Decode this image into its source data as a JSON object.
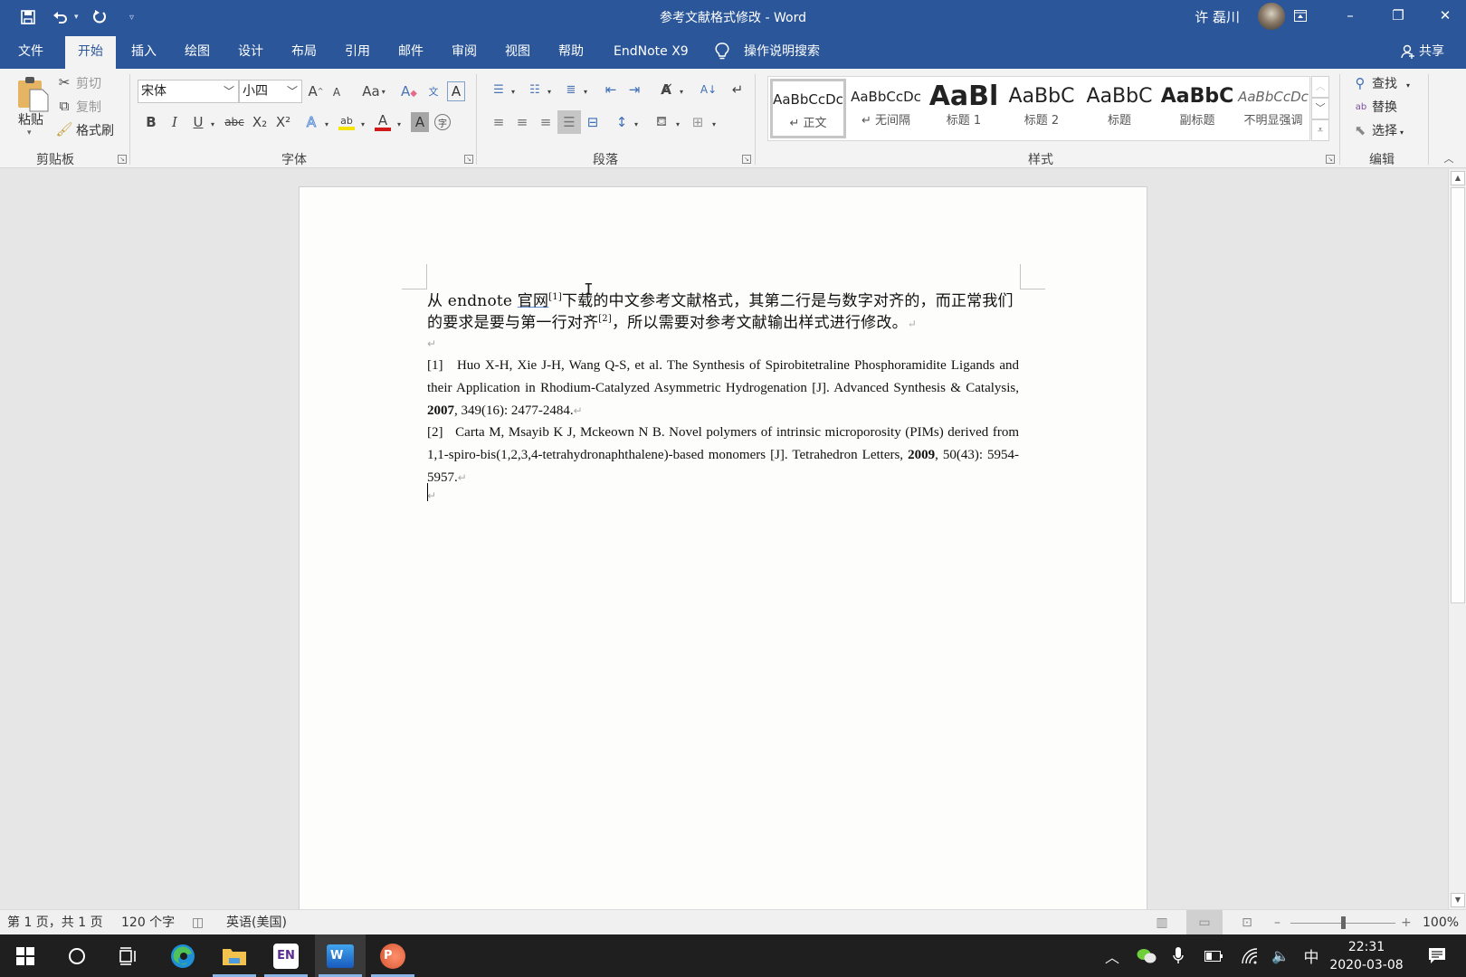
{
  "window": {
    "title": "参考文献格式修改  -  Word",
    "user_name": "许 磊川",
    "controls": {
      "ribbon_display": "▣",
      "minimize": "–",
      "restore": "❐",
      "close": "✕"
    }
  },
  "quick_access": {
    "save_icon": "save-icon",
    "undo_icon": "undo-icon",
    "redo_icon": "redo-icon",
    "customize_icon": "customize-icon"
  },
  "menu_tabs": [
    {
      "label": "文件"
    },
    {
      "label": "开始",
      "active": true
    },
    {
      "label": "插入"
    },
    {
      "label": "绘图"
    },
    {
      "label": "设计"
    },
    {
      "label": "布局"
    },
    {
      "label": "引用"
    },
    {
      "label": "邮件"
    },
    {
      "label": "审阅"
    },
    {
      "label": "视图"
    },
    {
      "label": "帮助"
    },
    {
      "label": "EndNote X9"
    }
  ],
  "tell_me": "操作说明搜索",
  "share": "共享",
  "ribbon": {
    "clipboard": {
      "label": "剪贴板",
      "paste": "粘贴",
      "cut": "剪切",
      "copy": "复制",
      "format_painter": "格式刷"
    },
    "font": {
      "label": "字体",
      "font_name": "宋体",
      "font_size": "小四",
      "grow": "A",
      "shrink": "A",
      "change_case": "Aa",
      "bold": "B",
      "italic": "I",
      "underline": "U",
      "strikethrough": "abc",
      "subscript": "X₂",
      "superscript": "X²",
      "text_effects": "A",
      "highlight": "ab",
      "font_color": "A",
      "char_shading": "A",
      "enclose": "字",
      "highlight_color": "#f5e400",
      "font_color_value": "#d01a1a"
    },
    "paragraph": {
      "label": "段落"
    },
    "styles": {
      "label": "样式",
      "items": [
        {
          "sample": "AaBbCcDc",
          "name": "↵ 正文",
          "selected": true
        },
        {
          "sample": "AaBbCcDc",
          "name": "↵ 无间隔"
        },
        {
          "sample": "AaBl",
          "name": "标题 1"
        },
        {
          "sample": "AaBbC",
          "name": "标题 2"
        },
        {
          "sample": "AaBbC",
          "name": "标题"
        },
        {
          "sample": "AaBbC",
          "name": "副标题"
        },
        {
          "sample": "AaBbCcDc",
          "name": "不明显强调"
        }
      ]
    },
    "editing": {
      "label": "编辑",
      "find": "查找",
      "replace": "替换",
      "select": "选择"
    }
  },
  "document": {
    "intro": {
      "part1": "从 endnote ",
      "link": "官网",
      "sup1": "[1]",
      "part2": "下载的中文参考文献格式，其第二行是与数字对齐的，而正常我们的要求是要与第一行对齐",
      "sup2": "[2]",
      "part3": "，所以需要对参考文献输出样式进行修改。"
    },
    "references": [
      {
        "num": "[1]",
        "before": "Huo X-H, Xie J-H, Wang Q-S, et al. The Synthesis of Spirobitetraline Phosphoramidite Ligands and their Application in Rhodium-Catalyzed Asymmetric Hydrogenation [J]. Advanced Synthesis & Catalysis, ",
        "year": "2007",
        "after": ", 349(16): 2477-2484."
      },
      {
        "num": "[2]",
        "before": "Carta M, Msayib K J, Mckeown N B. Novel polymers of intrinsic microporosity (PIMs) derived from 1,1-spiro-bis(1,2,3,4-tetrahydronaphthalene)-based monomers [J]. Tetrahedron Letters, ",
        "year": "2009",
        "after": ", 50(43): 5954-5957."
      }
    ],
    "paragraph_mark": "↵"
  },
  "status_bar": {
    "page": "第 1 页，共 1 页",
    "word_count": "120 个字",
    "language": "英语(美国)",
    "zoom": "100%",
    "zoom_percent": 100,
    "minus": "–",
    "plus": "+"
  },
  "taskbar": {
    "apps": [
      {
        "name": "Microsoft Edge"
      },
      {
        "name": "File Explorer"
      },
      {
        "name": "EndNote",
        "label": "EN"
      },
      {
        "name": "Word",
        "label": "W",
        "active": true
      },
      {
        "name": "PowerPoint",
        "label": "P"
      }
    ],
    "ime": "中",
    "time": "22:31",
    "date": "2020-03-08"
  }
}
